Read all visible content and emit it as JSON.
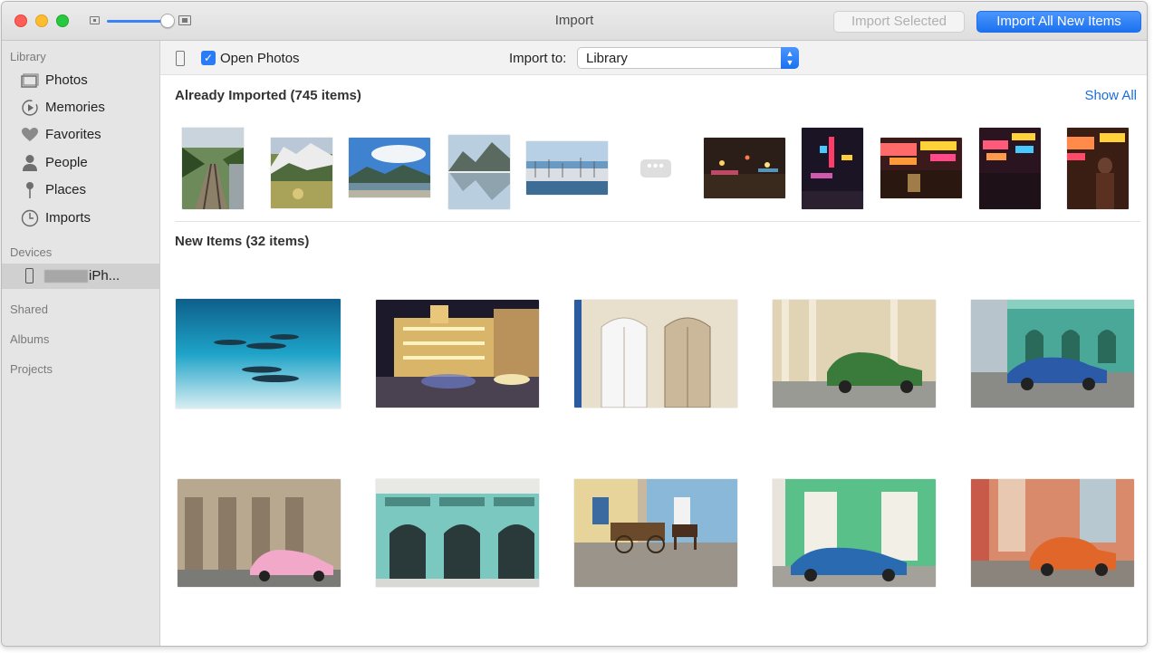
{
  "window": {
    "title": "Import",
    "import_selected_label": "Import Selected",
    "import_all_label": "Import All New Items"
  },
  "sidebar": {
    "library_header": "Library",
    "items": [
      {
        "label": "Photos",
        "icon": "photos-icon"
      },
      {
        "label": "Memories",
        "icon": "memories-icon"
      },
      {
        "label": "Favorites",
        "icon": "heart-icon"
      },
      {
        "label": "People",
        "icon": "person-icon"
      },
      {
        "label": "Places",
        "icon": "pin-icon"
      },
      {
        "label": "Imports",
        "icon": "clock-icon"
      }
    ],
    "devices_header": "Devices",
    "device_label": "iPh...",
    "shared_label": "Shared",
    "albums_label": "Albums",
    "projects_label": "Projects"
  },
  "toolbar": {
    "open_photos_label": "Open Photos",
    "open_photos_checked": true,
    "import_to_label": "Import to:",
    "import_to_value": "Library"
  },
  "already_imported": {
    "title": "Already Imported (745 items)",
    "show_all_label": "Show All",
    "more_indicator": "•••",
    "thumbnails": [
      {
        "subject": "railway-forest"
      },
      {
        "subject": "snowy-mountain-meadow"
      },
      {
        "subject": "mountain-lake-sky"
      },
      {
        "subject": "mountain-reflection"
      },
      {
        "subject": "harbor-boats"
      },
      {
        "subject": "night-street"
      },
      {
        "subject": "neon-signs-night"
      },
      {
        "subject": "neon-shopfront"
      },
      {
        "subject": "neon-street-night"
      },
      {
        "subject": "neon-person-night"
      }
    ]
  },
  "new_items": {
    "title": "New Items (32 items)",
    "thumbnails": [
      {
        "subject": "dolphins-underwater"
      },
      {
        "subject": "havana-night-building"
      },
      {
        "subject": "white-doors"
      },
      {
        "subject": "green-classic-car"
      },
      {
        "subject": "blue-car-green-building"
      },
      {
        "subject": "pink-classic-car"
      },
      {
        "subject": "teal-colonial-facade"
      },
      {
        "subject": "horse-cart"
      },
      {
        "subject": "blue-car-green-wall"
      },
      {
        "subject": "orange-classic-car"
      }
    ]
  },
  "colors": {
    "accent": "#1b72f0",
    "link": "#1a6ed8",
    "sidebar_bg": "#e6e5e6"
  }
}
